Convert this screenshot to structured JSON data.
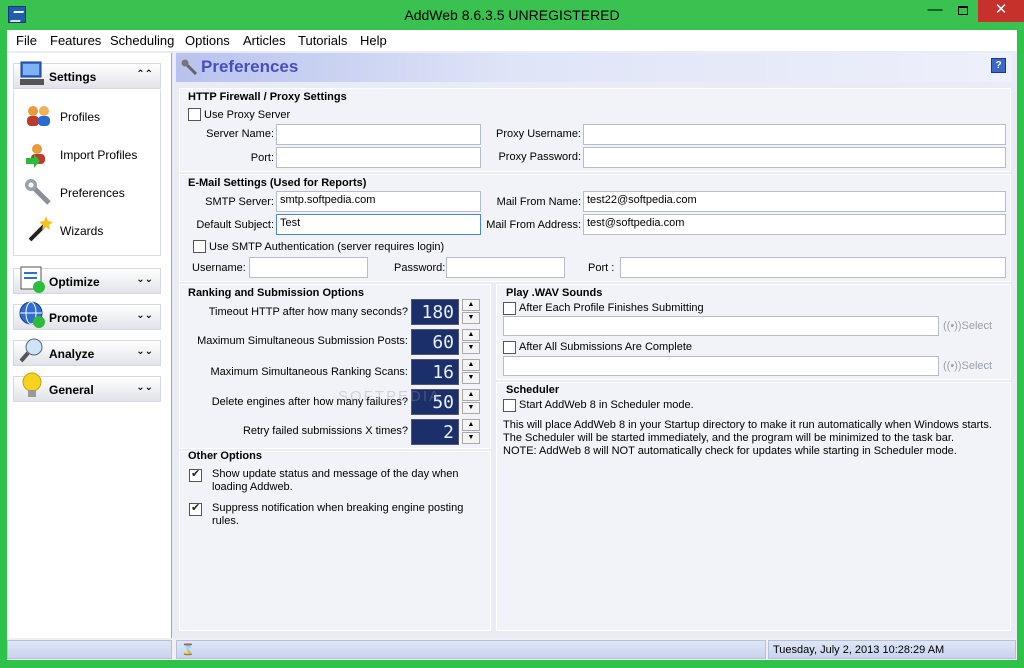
{
  "window": {
    "title": "AddWeb 8.6.3.5  UNREGISTERED",
    "min": "—",
    "close": "✕"
  },
  "menu": [
    "File",
    "Features",
    "Scheduling",
    "Options",
    "Articles",
    "Tutorials",
    "Help"
  ],
  "sidebar": {
    "settings": {
      "label": "Settings",
      "chevron": "⌃⌃"
    },
    "items": [
      {
        "label": "Profiles",
        "icon": "users-icon"
      },
      {
        "label": "Import Profiles",
        "icon": "import-users-icon"
      },
      {
        "label": "Preferences",
        "icon": "wrench-icon"
      },
      {
        "label": "Wizards",
        "icon": "magic-wand-icon"
      }
    ],
    "groups": [
      {
        "label": "Optimize",
        "chevron": "⌄⌄"
      },
      {
        "label": "Promote",
        "chevron": "⌄⌄"
      },
      {
        "label": "Analyze",
        "chevron": "⌄⌄"
      },
      {
        "label": "General",
        "chevron": "⌄⌄"
      }
    ]
  },
  "panel": {
    "title": "Preferences",
    "help": "?"
  },
  "proxy": {
    "title": "HTTP Firewall / Proxy Settings",
    "use_proxy": "Use Proxy Server",
    "server_name_label": "Server Name:",
    "port_label": "Port:",
    "proxy_user_label": "Proxy Username:",
    "proxy_pass_label": "Proxy Password:",
    "server_name": "",
    "port": "",
    "proxy_user": "",
    "proxy_pass": ""
  },
  "email": {
    "title": "E-Mail Settings (Used for Reports)",
    "smtp_label": "SMTP Server:",
    "smtp": "smtp.softpedia.com",
    "subject_label": "Default Subject:",
    "subject": "Test",
    "from_name_label": "Mail From Name:",
    "from_name": "test22@softpedia.com",
    "from_addr_label": "Mail From Address:",
    "from_addr": "test@softpedia.com",
    "smtp_auth": "Use SMTP Authentication (server requires login)",
    "user_label": "Username:",
    "pass_label": "Password:",
    "port_label": "Port :"
  },
  "ranking": {
    "title": "Ranking and Submission Options",
    "rows": [
      {
        "label": "Timeout HTTP after how many seconds?",
        "value": "180"
      },
      {
        "label": "Maximum Simultaneous Submission Posts:",
        "value": "60"
      },
      {
        "label": "Maximum Simultaneous Ranking Scans:",
        "value": "16"
      },
      {
        "label": "Delete engines after how many failures?",
        "value": "50"
      },
      {
        "label": "Retry failed submissions X times?",
        "value": "2"
      }
    ]
  },
  "other": {
    "title": "Other Options",
    "opt1": "Show update status and message of the day when loading Addweb.",
    "opt2": "Suppress notification when breaking engine posting rules."
  },
  "wav": {
    "title": "Play .WAV Sounds",
    "after_each": "After Each Profile Finishes Submitting",
    "after_all": "After All Submissions Are Complete",
    "select": "Select"
  },
  "scheduler": {
    "title": "Scheduler",
    "start": "Start AddWeb 8 in Scheduler mode.",
    "line1": "This will place AddWeb 8 in your Startup directory to make it run automatically when Windows starts.",
    "line2": "The Scheduler will be started immediately, and the program will be minimized to the task bar.",
    "line3": "NOTE:  AddWeb 8 will NOT automatically check for updates while starting in Scheduler mode."
  },
  "status": {
    "datetime": "Tuesday, July 2, 2013 10:28:29 AM"
  },
  "watermark": "SOFTPEDIA"
}
